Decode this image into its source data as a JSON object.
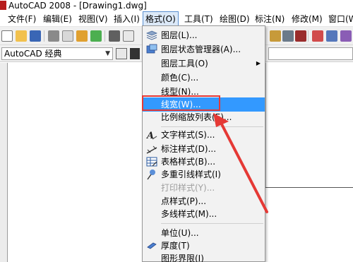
{
  "window": {
    "title": "AutoCAD 2008 - [Drawing1.dwg]"
  },
  "menubar": [
    {
      "label": "文件(F)"
    },
    {
      "label": "编辑(E)"
    },
    {
      "label": "视图(V)"
    },
    {
      "label": "插入(I)"
    },
    {
      "label": "格式(O)",
      "active": true
    },
    {
      "label": "工具(T)"
    },
    {
      "label": "绘图(D)"
    },
    {
      "label": "标注(N)"
    },
    {
      "label": "修改(M)"
    },
    {
      "label": "窗口(W"
    }
  ],
  "workspace": {
    "value": "AutoCAD 经典"
  },
  "format_menu": {
    "items": [
      {
        "label": "图层(L)...",
        "icon": "layers-icon"
      },
      {
        "label": "图层状态管理器(A)...",
        "icon": "layer-states-icon"
      },
      {
        "label": "图层工具(O)",
        "submenu": true
      },
      {
        "label": "颜色(C)..."
      },
      {
        "label": "线型(N)..."
      },
      {
        "label": "线宽(W)...",
        "highlighted": true
      },
      {
        "label": "比例缩放列表(E)..."
      },
      {
        "label": "文字样式(S)...",
        "icon": "text-style-icon"
      },
      {
        "label": "标注样式(D)...",
        "icon": "dimension-style-icon"
      },
      {
        "label": "表格样式(B)...",
        "icon": "table-style-icon"
      },
      {
        "label": "多重引线样式(I)",
        "icon": "multileader-style-icon"
      },
      {
        "label": "打印样式(Y)...",
        "disabled": true
      },
      {
        "label": "点样式(P)..."
      },
      {
        "label": "多线样式(M)..."
      },
      {
        "label": "单位(U)..."
      },
      {
        "label": "厚度(T)",
        "icon": "thickness-icon"
      },
      {
        "label": "图形界限(I)"
      }
    ]
  },
  "colors": {
    "highlight": "#3399ff",
    "annotation": "#e53935"
  }
}
